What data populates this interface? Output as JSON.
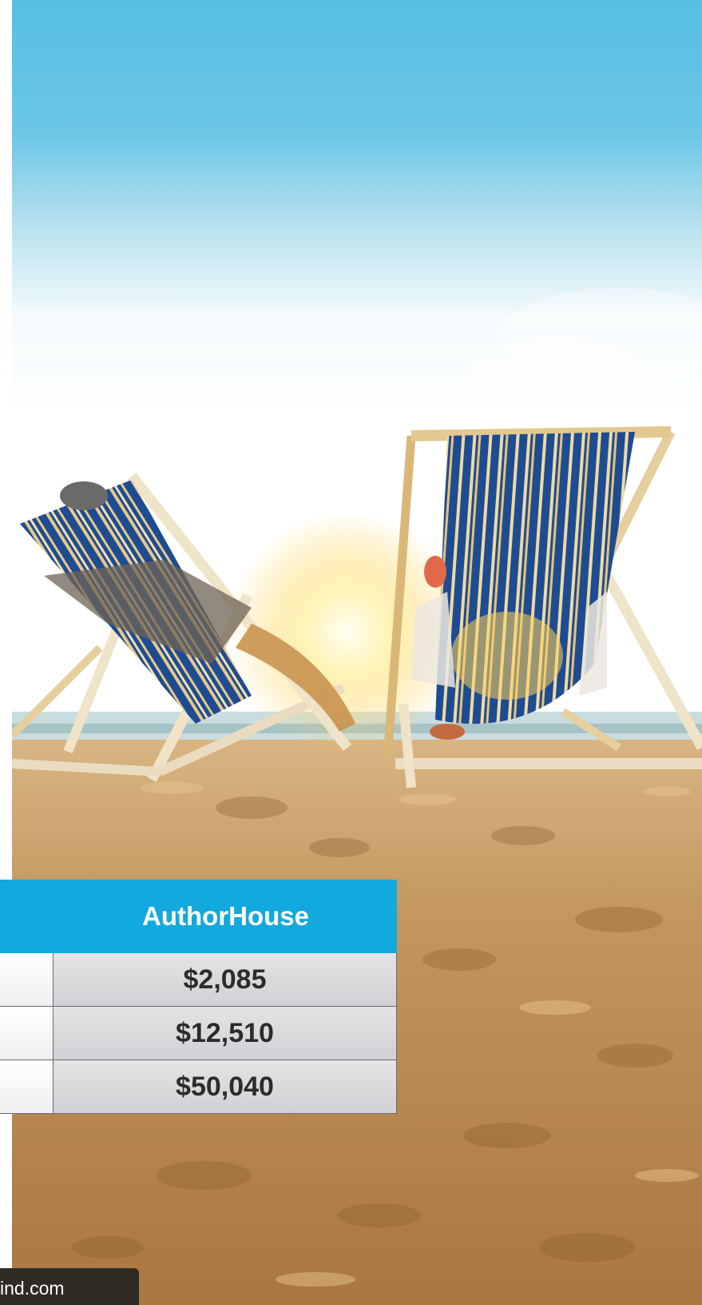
{
  "comparison_table": {
    "header_label": "AuthorHouse",
    "rows": [
      {
        "left": "",
        "value": "$2,085"
      },
      {
        "left": "",
        "value": "$12,510"
      },
      {
        "left": "",
        "value": "$50,040"
      }
    ]
  },
  "footer": {
    "url_fragment": "ind.com"
  },
  "colors": {
    "header_blue": "#12a9df",
    "sky_top": "#55bfe4",
    "chair_stripe": "#1d4c93",
    "sand": "#b98a4f"
  },
  "icons": [
    "beach-chair-icon",
    "sun-glow-icon"
  ]
}
